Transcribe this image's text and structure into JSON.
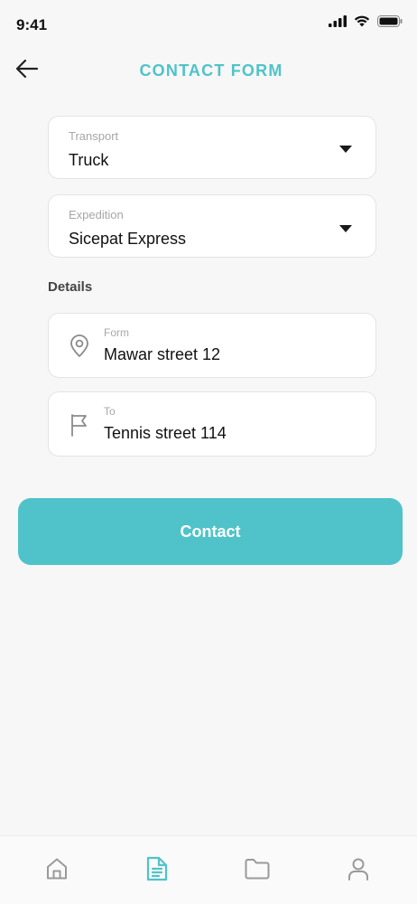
{
  "status_bar": {
    "time": "9:41",
    "icons": [
      "signal-icon",
      "wifi-icon",
      "battery-icon"
    ]
  },
  "header": {
    "back_icon": "arrow-left-icon",
    "title": "CONTACT FORM"
  },
  "form": {
    "transport": {
      "label": "Transport",
      "value": "Truck"
    },
    "expedition": {
      "label": "Expedition",
      "value": "Sicepat Express"
    },
    "details_label": "Details",
    "from": {
      "label": "Form",
      "value": "Mawar street 12",
      "icon": "location-pin-icon"
    },
    "to": {
      "label": "To",
      "value": "Tennis street 114",
      "icon": "flag-icon"
    }
  },
  "actions": {
    "contact_label": "Contact"
  },
  "bottom_nav": {
    "items": [
      {
        "name": "home",
        "icon": "home-icon",
        "active": false
      },
      {
        "name": "document",
        "icon": "document-icon",
        "active": true
      },
      {
        "name": "folder",
        "icon": "folder-icon",
        "active": false
      },
      {
        "name": "profile",
        "icon": "user-icon",
        "active": false
      }
    ]
  },
  "colors": {
    "accent": "#4fc3c9",
    "background": "#f7f7f7",
    "text": "#111111",
    "muted": "#a7a7a7"
  }
}
